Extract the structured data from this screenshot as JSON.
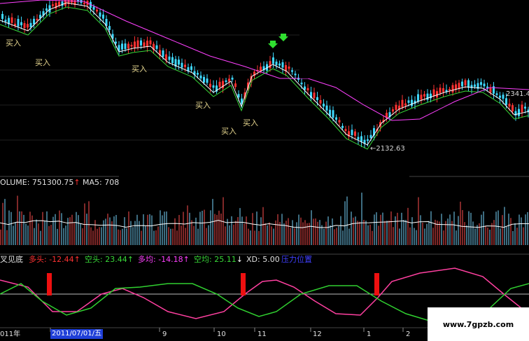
{
  "price_chart": {
    "buy_signals": [
      {
        "label": "买入"
      },
      {
        "label": "买入"
      },
      {
        "label": "买入"
      },
      {
        "label": "买入"
      },
      {
        "label": "买入"
      },
      {
        "label": "买入"
      }
    ],
    "low_marker": "←2132.63",
    "high_marker": "2341.4",
    "colors": {
      "up": "#ff3232",
      "down": "#3fd8ff",
      "ma_fast": "#ffffff",
      "ma_mid": "#d6d636",
      "ma_slow": "#ff40ff",
      "ma_green": "#38d838"
    }
  },
  "volume_panel": {
    "volume_label": "OLUME: 751300.75",
    "volume_arrow": "↑",
    "ma5_label": "MA5: 708"
  },
  "indicator_panel": {
    "title": "叉见底",
    "items": [
      {
        "label": "多头: -12.44",
        "arrow": "↑",
        "color": "#ff3232"
      },
      {
        "label": "空头: 23.44",
        "arrow": "↑",
        "color": "#38d838"
      },
      {
        "label": "多均: -14.18",
        "arrow": "↑",
        "color": "#ff40ff"
      },
      {
        "label": "空均: 25.11",
        "arrow": "↓",
        "color": "#38d838"
      },
      {
        "label": "XD: 5.00",
        "arrow": "",
        "color": "#ffffff"
      }
    ],
    "blue_tag": "压力位置"
  },
  "time_axis": {
    "first_label": "011年",
    "cursor_date": "2011/07/01/五",
    "months": [
      "9",
      "10",
      "11",
      "12",
      "1",
      "2"
    ]
  },
  "watermark": "www.7gpzb.com"
}
